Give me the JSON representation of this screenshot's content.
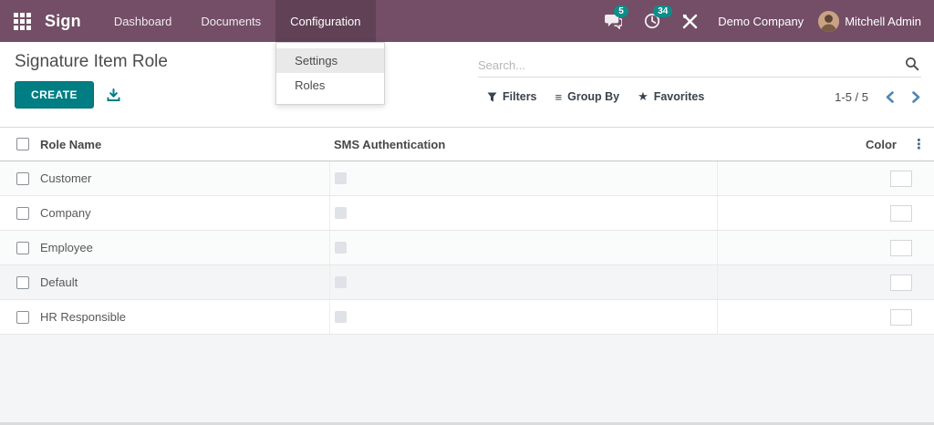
{
  "nav": {
    "brand": "Sign",
    "items": [
      {
        "label": "Dashboard",
        "active": false
      },
      {
        "label": "Documents",
        "active": false
      },
      {
        "label": "Configuration",
        "active": true
      }
    ],
    "messages_badge": "5",
    "activities_badge": "34",
    "company": "Demo Company",
    "user": "Mitchell Admin"
  },
  "dropdown": {
    "items": [
      {
        "label": "Settings",
        "highlighted": true
      },
      {
        "label": "Roles",
        "highlighted": false
      }
    ]
  },
  "page": {
    "title": "Signature Item Role",
    "create_label": "CREATE"
  },
  "search": {
    "placeholder": "Search..."
  },
  "controls": {
    "filters": "Filters",
    "group_by": "Group By",
    "favorites": "Favorites",
    "pager": "1-5 / 5"
  },
  "table": {
    "headers": {
      "role_name": "Role Name",
      "sms": "SMS Authentication",
      "color": "Color"
    },
    "rows": [
      {
        "role_name": "Customer",
        "sms_auth": false,
        "color": "#f3c319",
        "pattern": null,
        "shaded": false,
        "tinted": true
      },
      {
        "role_name": "Company",
        "sms_auth": false,
        "color": "#da1a5e",
        "pattern": null,
        "shaded": false,
        "tinted": false
      },
      {
        "role_name": "Employee",
        "sms_auth": false,
        "color": "#35c183",
        "pattern": null,
        "shaded": false,
        "tinted": true
      },
      {
        "role_name": "Default",
        "sms_auth": false,
        "color": null,
        "pattern": null,
        "shaded": true,
        "tinted": false
      },
      {
        "role_name": "HR Responsible",
        "sms_auth": false,
        "color": "#8a62ca",
        "pattern": "dots",
        "shaded": false,
        "tinted": false
      }
    ]
  },
  "icons": {
    "group_by_icon": "≡",
    "favorites_icon": "★",
    "dots_icon": "⋮"
  },
  "colors": {
    "navbar_bg": "#734e66",
    "primary_button": "#017e84",
    "badge_teal": "#0e8c89",
    "pager_arrows": "#4e87b5",
    "no_color_stroke": "#d8195c"
  }
}
